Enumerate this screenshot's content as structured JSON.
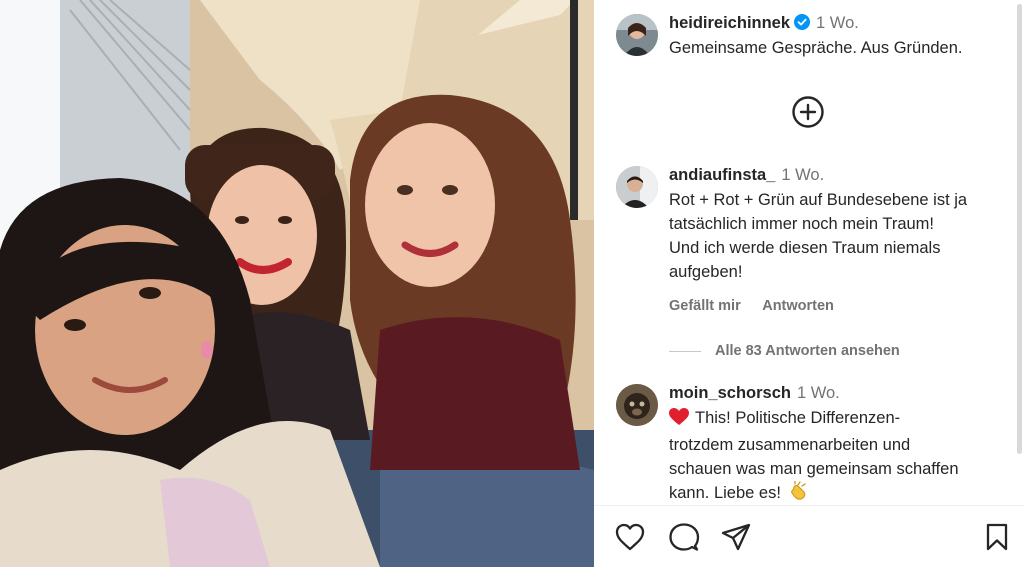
{
  "post": {
    "author": "heidireichinnek",
    "time": "1 Wo.",
    "caption": "Gemeinsame Gespräche. Aus Gründen."
  },
  "comments": [
    {
      "user": "andiaufinsta_",
      "time": "1 Wo.",
      "lines": [
        "Rot + Rot + Grün auf Bundesebene ist ja",
        "tatsächlich immer noch mein Traum!",
        "Und ich werde diesen Traum niemals",
        "aufgeben!"
      ],
      "like_label": "Gefällt mir",
      "reply_label": "Antworten",
      "view_replies": "Alle 83 Antworten ansehen"
    },
    {
      "user": "moin_schorsch",
      "time": "1 Wo.",
      "lines": [
        "This! Politische Differenzen-",
        "trotzdem zusammenarbeiten und",
        "schauen was man gemeinsam schaffen",
        "kann. Liebe es!"
      ]
    }
  ],
  "icons": {
    "verified": "verified-badge-icon",
    "add": "plus-circle-icon",
    "heart": "heart-icon",
    "comment": "comment-icon",
    "share": "paper-plane-icon",
    "save": "bookmark-icon",
    "red_heart_emoji": "red-heart-icon",
    "clap_emoji": "clapping-hands-icon"
  },
  "colors": {
    "verified": "#0095f6",
    "muted": "#737373",
    "text": "#262626"
  }
}
